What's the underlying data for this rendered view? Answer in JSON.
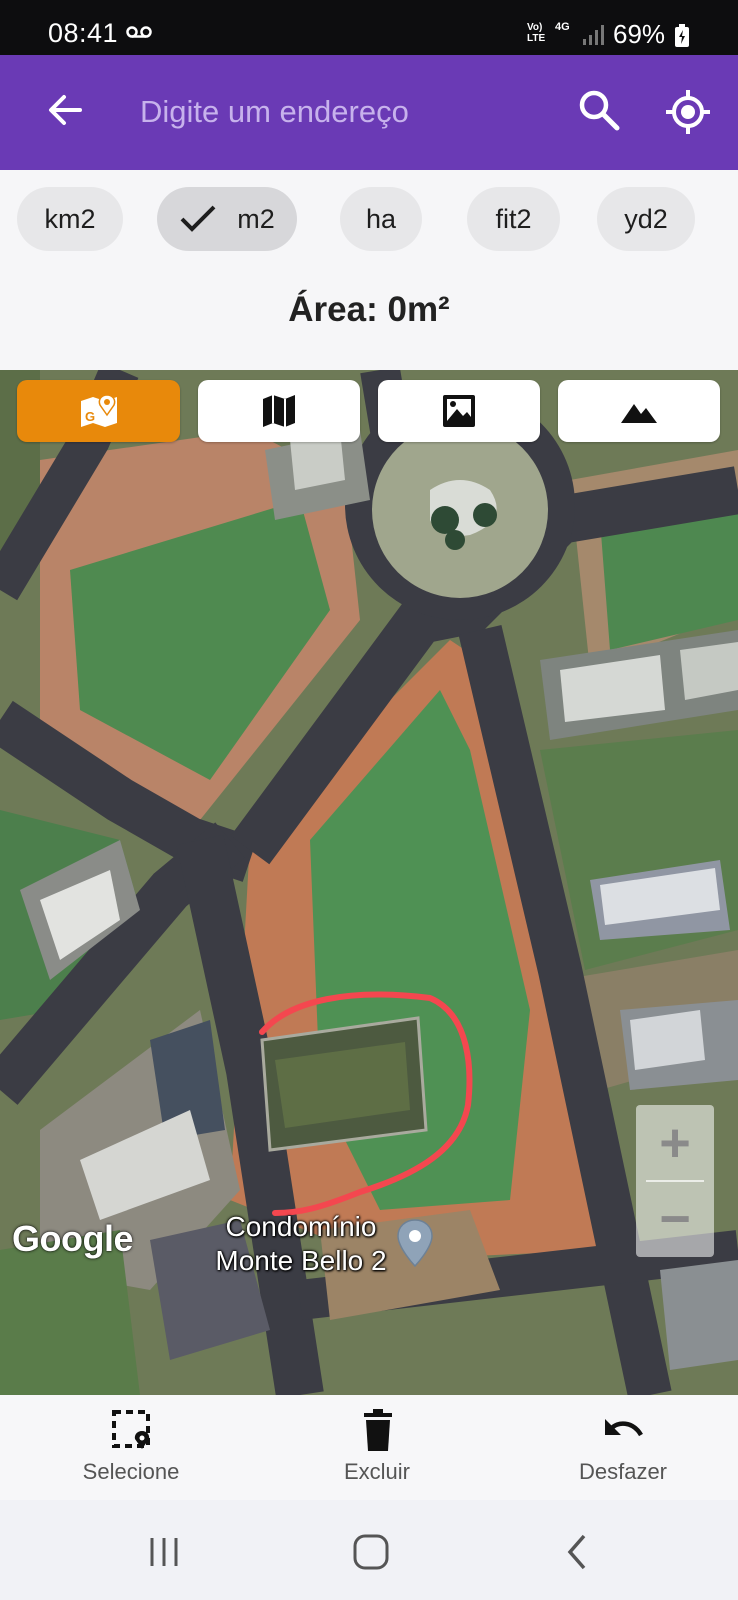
{
  "status_bar": {
    "time": "08:41",
    "volte": "Vo) LTE",
    "network": "4G",
    "battery": "69%",
    "icons": [
      "voicemail-icon",
      "volte-icon",
      "signal-icon",
      "battery-charging-icon"
    ]
  },
  "app_bar": {
    "background": "#6a3ab5",
    "search_placeholder": "Digite um endereço",
    "icons": [
      "back-arrow-icon",
      "search-icon",
      "my-location-icon"
    ]
  },
  "units": {
    "chips": [
      {
        "label": "km2",
        "selected": false
      },
      {
        "label": "m2",
        "selected": true
      },
      {
        "label": "ha",
        "selected": false
      },
      {
        "label": "fit2",
        "selected": false
      },
      {
        "label": "yd2",
        "selected": false
      }
    ]
  },
  "area": {
    "text": "Área: 0m²"
  },
  "map": {
    "type_buttons": [
      {
        "icon": "google-maps-icon",
        "active": true
      },
      {
        "icon": "map-icon",
        "active": false
      },
      {
        "icon": "satellite-image-icon",
        "active": false
      },
      {
        "icon": "terrain-icon",
        "active": false
      }
    ],
    "accent_color": "#e8890b",
    "zoom_in": "+",
    "zoom_out": "−",
    "logo": "Google",
    "place_label": "Condomínio Monte Bello 2",
    "drawn_stroke_color": "#f4474f"
  },
  "bottom_toolbar": {
    "select_label": "Selecione",
    "delete_label": "Excluir",
    "undo_label": "Desfazer"
  },
  "system_nav": {
    "icons": [
      "recent-apps-icon",
      "home-icon",
      "back-icon"
    ]
  }
}
